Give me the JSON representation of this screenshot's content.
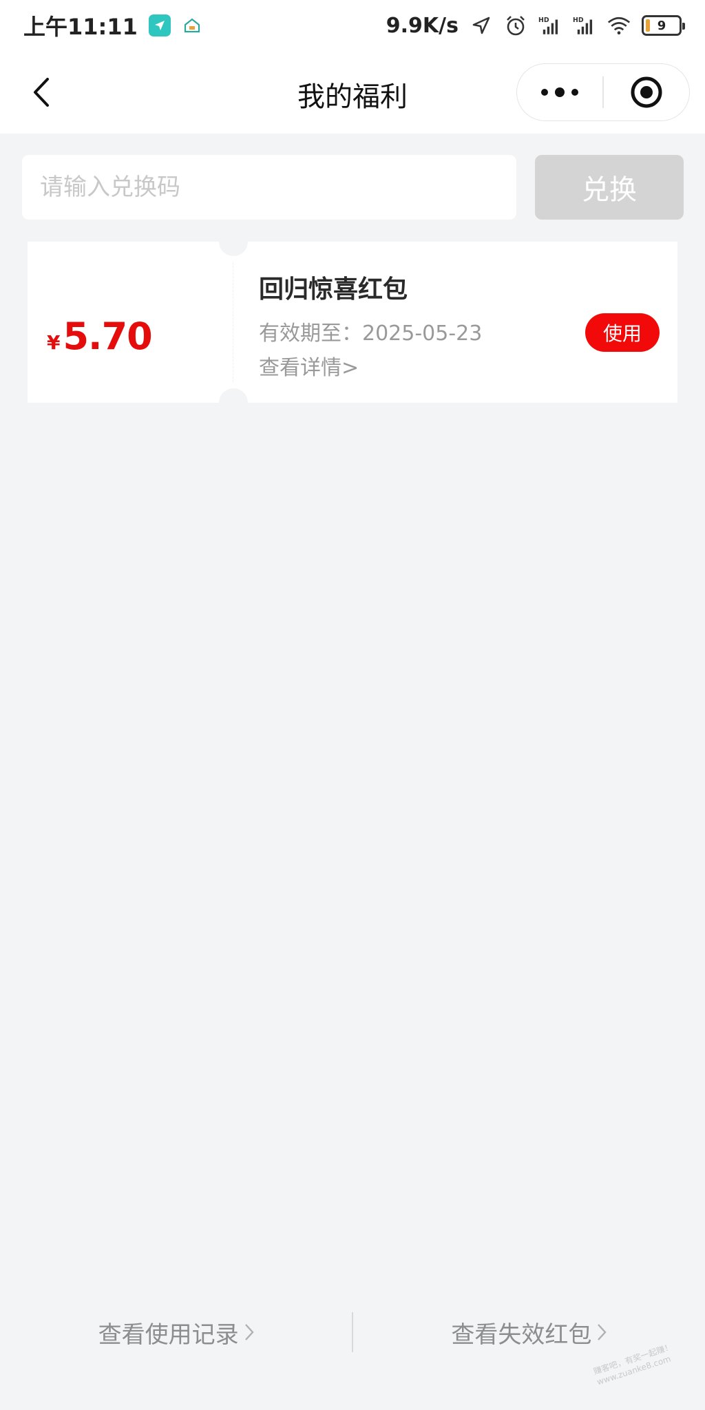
{
  "status_bar": {
    "time": "上午11:11",
    "network_speed": "9.9K/s",
    "battery_level": "9",
    "icons": [
      "location-app-icon",
      "home-app-icon",
      "location-arrow-icon",
      "alarm-icon",
      "signal-hd-icon",
      "signal-hd-icon",
      "wifi-icon",
      "battery-icon"
    ]
  },
  "nav": {
    "title": "我的福利",
    "back_icon": "chevron-left-icon",
    "more_icon": "more-dots-icon",
    "close_icon": "target-circle-icon"
  },
  "redeem": {
    "placeholder": "请输入兑换码",
    "value": "",
    "button_label": "兑换"
  },
  "coupons": [
    {
      "currency": "¥",
      "amount": "5.70",
      "title": "回归惊喜红包",
      "expiry": "有效期至：2025-05-23",
      "detail_link": "查看详情>",
      "use_label": "使用"
    }
  ],
  "footer": {
    "usage_record": "查看使用记录",
    "expired_packets": "查看失效红包"
  },
  "watermark": {
    "line1": "赚客吧，有奖一起赚！",
    "line2": "www.zuanke8.com"
  },
  "colors": {
    "accent_red": "#e50c0c",
    "use_button": "#f20a0a",
    "background": "#f3f4f6",
    "disabled_button": "#d4d4d4"
  }
}
